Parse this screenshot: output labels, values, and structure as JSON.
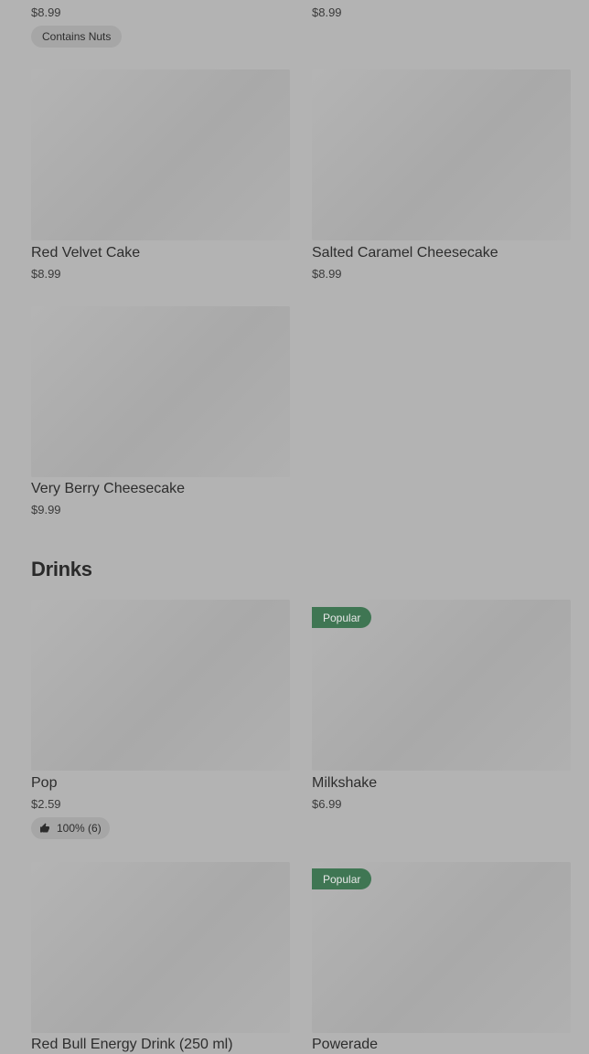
{
  "top_row": {
    "left": {
      "price": "$8.99",
      "tag": "Contains Nuts"
    },
    "right": {
      "price": "$8.99"
    }
  },
  "items": {
    "red_velvet": {
      "name": "Red Velvet Cake",
      "price": "$8.99"
    },
    "salted_caramel": {
      "name": "Salted Caramel Cheesecake",
      "price": "$8.99"
    },
    "very_berry": {
      "name": "Very Berry Cheesecake",
      "price": "$9.99"
    }
  },
  "drinks": {
    "title": "Drinks",
    "pop": {
      "name": "Pop",
      "price": "$2.59",
      "rating": "100% (6)"
    },
    "milkshake": {
      "name": "Milkshake",
      "price": "$6.99",
      "badge": "Popular"
    },
    "red_bull": {
      "name": "Red Bull Energy Drink (250 ml)"
    },
    "powerade": {
      "name": "Powerade",
      "badge": "Popular"
    }
  },
  "colors": {
    "background": "#b3b3b3",
    "popular_badge": "#3f7653"
  },
  "icons": {
    "rating": "thumbs-up-icon"
  }
}
